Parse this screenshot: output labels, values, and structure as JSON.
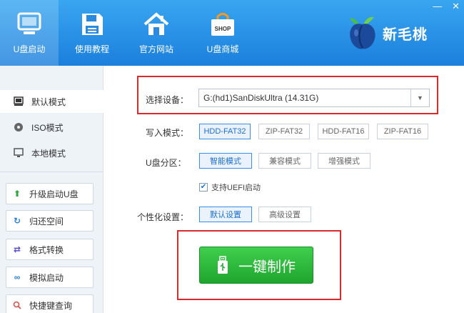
{
  "nav": {
    "tabs": [
      {
        "label": "U盘启动",
        "icon": "monitor-icon",
        "active": true
      },
      {
        "label": "使用教程",
        "icon": "floppy-disk-icon",
        "active": false
      },
      {
        "label": "官方网站",
        "icon": "home-icon",
        "active": false
      },
      {
        "label": "U盘商城",
        "icon": "shopping-bag-icon",
        "active": false
      }
    ],
    "shop_badge": "SHOP"
  },
  "brand": {
    "name": "新毛桃"
  },
  "window_controls": {
    "minimize": "—",
    "close": "✕"
  },
  "sidebar": {
    "modes": [
      {
        "label": "默认模式",
        "icon": "usb-drive-icon",
        "active": true
      },
      {
        "label": "ISO模式",
        "icon": "disc-icon",
        "active": false
      },
      {
        "label": "本地模式",
        "icon": "monitor-icon",
        "active": false
      }
    ],
    "tools": [
      {
        "label": "升级启动U盘",
        "icon": "arrow-up-icon"
      },
      {
        "label": "归还空间",
        "icon": "refresh-icon"
      },
      {
        "label": "格式转换",
        "icon": "swap-icon"
      },
      {
        "label": "模拟启动",
        "icon": "link-icon"
      },
      {
        "label": "快捷键查询",
        "icon": "search-icon"
      }
    ]
  },
  "main": {
    "device": {
      "label": "选择设备：",
      "value": "G:(hd1)SanDiskUltra (14.31G)"
    },
    "write_mode": {
      "label": "写入模式：",
      "options": [
        "HDD-FAT32",
        "ZIP-FAT32",
        "HDD-FAT16",
        "ZIP-FAT16"
      ],
      "selected": "HDD-FAT32"
    },
    "partition": {
      "label": "U盘分区：",
      "options": [
        "智能模式",
        "兼容模式",
        "增强模式"
      ],
      "selected": "智能模式"
    },
    "uefi": {
      "label": "支持UEFI启动",
      "checked": true
    },
    "personalize": {
      "label": "个性化设置：",
      "options": [
        "默认设置",
        "高级设置"
      ],
      "selected": "默认设置"
    },
    "make_button": "一键制作"
  },
  "colors": {
    "accent": "#1d6fcf",
    "highlight": "#d92b2b",
    "make_button": "#2bb83b",
    "topbar": "#2490e6"
  }
}
